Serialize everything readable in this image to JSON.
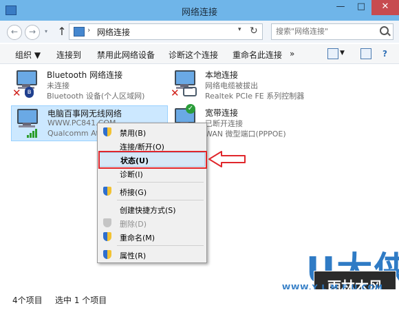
{
  "window": {
    "title": "网络连接",
    "min": "—",
    "max": "□",
    "close": "✕"
  },
  "address": {
    "separator": "›",
    "path": "网络连接",
    "dropdown": "▾",
    "refresh": "↻",
    "search_placeholder": "搜索\"网络连接\""
  },
  "nav": {
    "back": "←",
    "forward": "→",
    "history": "▾",
    "up": "↑"
  },
  "toolbar": {
    "organize": "组织 ▼",
    "connect": "连接到",
    "disable": "禁用此网络设备",
    "diagnose": "诊断这个连接",
    "rename": "重命名此连接",
    "more": "»",
    "view_dd": "▼",
    "help": "?"
  },
  "connections": [
    {
      "name": "Bluetooth 网络连接",
      "status": "未连接",
      "device": "Bluetooth 设备(个人区域网)"
    },
    {
      "name": "本地连接",
      "status": "网络电缆被拔出",
      "device": "Realtek PCIe FE 系列控制器"
    },
    {
      "name": "电脑百事网无线网络",
      "status": "WWW.PC841.COM",
      "device": "Qualcomm At"
    },
    {
      "name": "宽带连接",
      "status": "已断开连接",
      "device": "WAN 微型端口(PPPOE)"
    }
  ],
  "context_menu": {
    "disable": "禁用(B)",
    "connect": "连接/断开(O)",
    "status": "状态(U)",
    "diagnose": "诊断(I)",
    "bridge": "桥接(G)",
    "shortcut": "创建快捷方式(S)",
    "delete": "删除(D)",
    "rename": "重命名(M)",
    "properties": "属性(R)"
  },
  "statusbar": {
    "count": "4个项目",
    "selected": "选中 1 个项目"
  },
  "watermark": {
    "logo": "U大侠",
    "url": "WWW.Y L M F U.COM",
    "badge": "雨林木风"
  },
  "colors": {
    "accent": "#6fb5e9",
    "selection": "#cce8ff",
    "highlight_box": "#e0262b",
    "watermark": "#2f7bc5"
  }
}
